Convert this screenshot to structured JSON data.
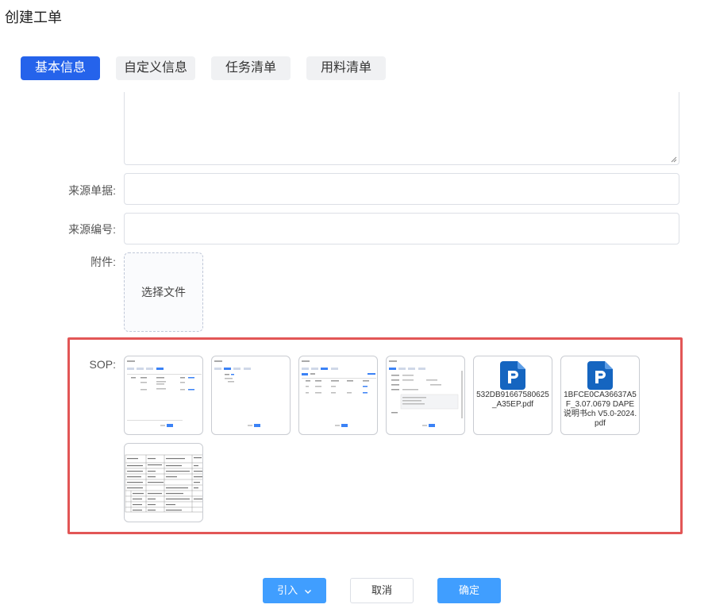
{
  "page_title": "创建工单",
  "tabs": [
    {
      "label": "基本信息",
      "active": true
    },
    {
      "label": "自定义信息",
      "active": false
    },
    {
      "label": "任务清单",
      "active": false
    },
    {
      "label": "用料清单",
      "active": false
    }
  ],
  "form": {
    "source_doc_label": "来源单据:",
    "source_no_label": "来源编号:",
    "attachment_label": "附件:",
    "choose_file": "选择文件",
    "sop_label": "SOP:"
  },
  "sop_files": [
    {
      "type": "image"
    },
    {
      "type": "image"
    },
    {
      "type": "image"
    },
    {
      "type": "image"
    },
    {
      "type": "pdf",
      "name": "532DB91667580625_A35EP.pdf",
      "icon": "pdf-icon"
    },
    {
      "type": "pdf",
      "name": "1BFCE0CA36637A5F_3.07.0679 DAPE说明书ch V5.0-2024.pdf",
      "icon": "pdf-icon"
    },
    {
      "type": "image"
    }
  ],
  "buttons": {
    "import": "引入",
    "cancel": "取消",
    "confirm": "确定"
  },
  "colors": {
    "accent": "#2563eb",
    "primary_button": "#409eff",
    "highlight_border": "#e25656",
    "pdf_icon": "#1565c0"
  }
}
